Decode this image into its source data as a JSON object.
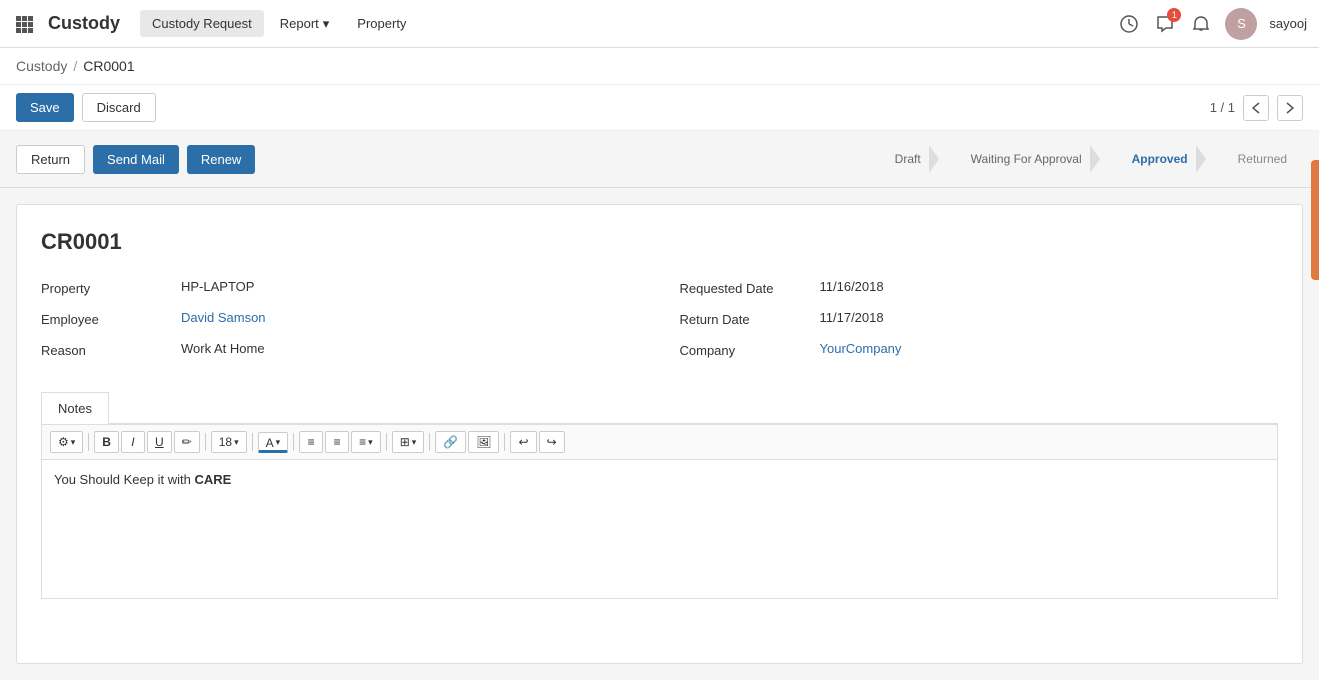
{
  "nav": {
    "brand": "Custody",
    "items": [
      {
        "label": "Custody Request",
        "active": true
      },
      {
        "label": "Report",
        "dropdown": true
      },
      {
        "label": "Property",
        "active": false
      }
    ],
    "icons": {
      "clock": "🕐",
      "chat": "💬",
      "bell": "🔔"
    },
    "notification_count": "1",
    "username": "sayooj"
  },
  "breadcrumb": {
    "parent": "Custody",
    "separator": "/",
    "current": "CR0001"
  },
  "toolbar": {
    "save_label": "Save",
    "discard_label": "Discard",
    "pagination": "1 / 1"
  },
  "actions": {
    "return_label": "Return",
    "send_mail_label": "Send Mail",
    "renew_label": "Renew"
  },
  "status_steps": [
    {
      "label": "Draft",
      "state": "done"
    },
    {
      "label": "Waiting For Approval",
      "state": "done"
    },
    {
      "label": "Approved",
      "state": "active"
    },
    {
      "label": "Returned",
      "state": "none"
    }
  ],
  "record": {
    "title": "CR0001",
    "property_label": "Property",
    "property_value": "HP-LAPTOP",
    "employee_label": "Employee",
    "employee_value": "David Samson",
    "reason_label": "Reason",
    "reason_value": "Work At Home",
    "requested_date_label": "Requested Date",
    "requested_date_value": "11/16/2018",
    "return_date_label": "Return Date",
    "return_date_value": "11/17/2018",
    "company_label": "Company",
    "company_value": "YourCompany"
  },
  "notes": {
    "tab_label": "Notes",
    "editor": {
      "font_size": "18",
      "content_plain": "You Should Keep it with ",
      "content_bold": "CARE"
    },
    "toolbar_buttons": [
      {
        "label": "⚙",
        "title": "styles"
      },
      {
        "label": "B",
        "title": "bold"
      },
      {
        "label": "I",
        "title": "italic"
      },
      {
        "label": "U",
        "title": "underline"
      },
      {
        "label": "A",
        "title": "eraser"
      },
      {
        "label": "18",
        "title": "font-size",
        "dropdown": true
      },
      {
        "label": "A",
        "title": "font-color",
        "dropdown": true
      },
      {
        "label": "≡",
        "title": "unordered-list"
      },
      {
        "label": "≡",
        "title": "ordered-list"
      },
      {
        "label": "≡",
        "title": "align",
        "dropdown": true
      },
      {
        "label": "⊞",
        "title": "table",
        "dropdown": true
      },
      {
        "label": "🔗",
        "title": "link"
      },
      {
        "label": "🖼",
        "title": "image"
      },
      {
        "label": "↩",
        "title": "undo"
      },
      {
        "label": "↪",
        "title": "redo"
      }
    ]
  }
}
